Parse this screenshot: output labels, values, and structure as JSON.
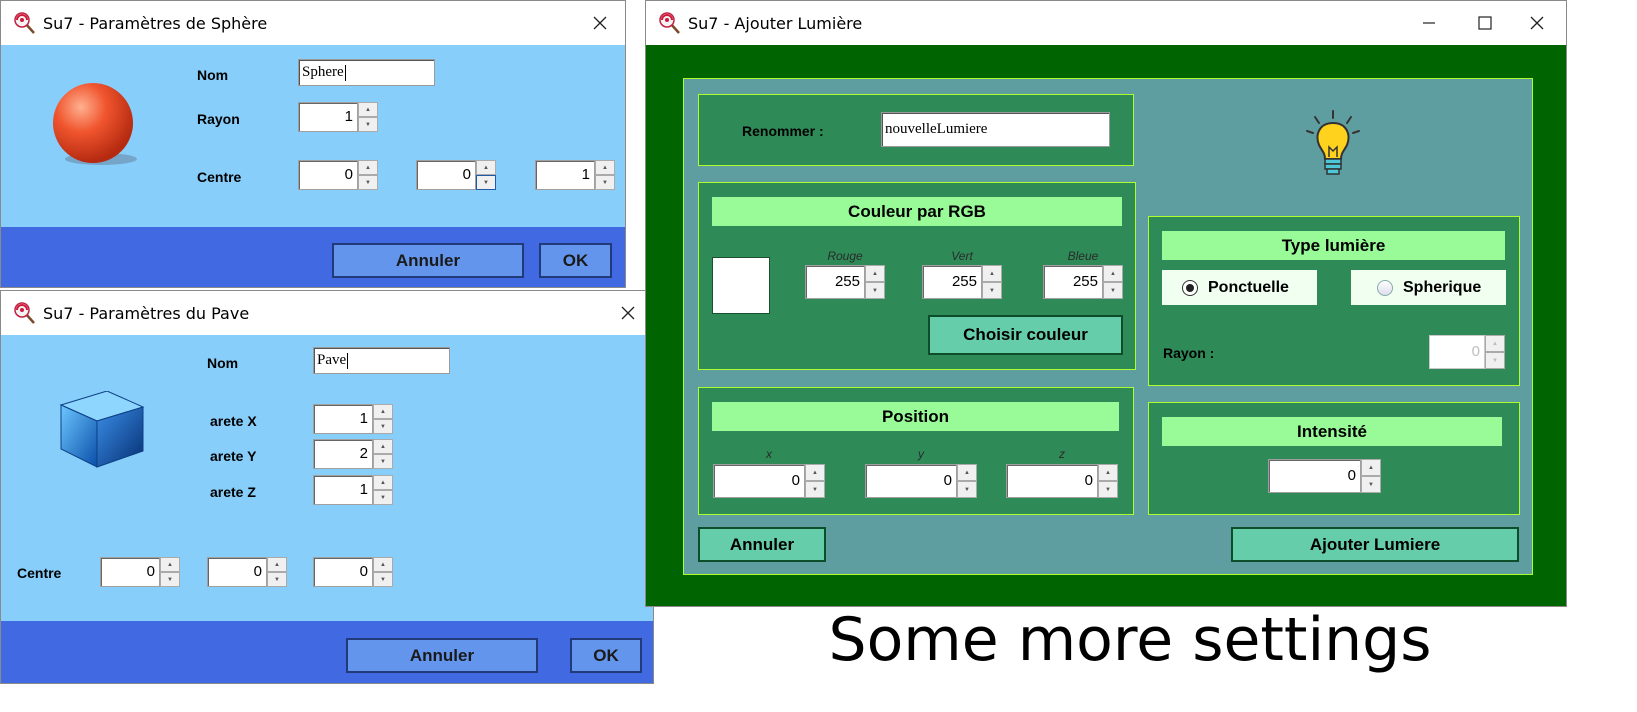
{
  "sphere_window": {
    "title": "Su7 - Paramètres de Sphère",
    "name_label": "Nom",
    "name_value": "Sphere",
    "rayon_label": "Rayon",
    "rayon_value": "1",
    "centre_label": "Centre",
    "centre_values": [
      "0",
      "0",
      "1"
    ],
    "cancel_label": "Annuler",
    "ok_label": "OK",
    "colors": {
      "body": "#87cefa",
      "footer": "#4169e1",
      "button": "#6495ed"
    }
  },
  "pave_window": {
    "title": "Su7 - Paramètres du Pave",
    "name_label": "Nom",
    "name_value": "Pave",
    "edges": [
      {
        "label": "arete X",
        "value": "1"
      },
      {
        "label": "arete Y",
        "value": "2"
      },
      {
        "label": "arete Z",
        "value": "1"
      }
    ],
    "centre_label": "Centre",
    "centre_values": [
      "0",
      "0",
      "0"
    ],
    "cancel_label": "Annuler",
    "ok_label": "OK"
  },
  "light_window": {
    "title": "Su7 - Ajouter Lumière",
    "rename_label": "Renommer :",
    "rename_value": "nouvelleLumiere",
    "color_header": "Couleur par RGB",
    "rgb": [
      {
        "label": "Rouge",
        "value": "255"
      },
      {
        "label": "Vert",
        "value": "255"
      },
      {
        "label": "Bleue",
        "value": "255"
      }
    ],
    "color_preview": "#ffffff",
    "choose_color_label": "Choisir couleur",
    "position_header": "Position",
    "position": [
      {
        "label": "x",
        "value": "0"
      },
      {
        "label": "y",
        "value": "0"
      },
      {
        "label": "z",
        "value": "0"
      }
    ],
    "type_header": "Type lumière",
    "type_options": [
      {
        "label": "Ponctuelle",
        "selected": true
      },
      {
        "label": "Spherique",
        "selected": false
      }
    ],
    "rayon_label": "Rayon :",
    "rayon_value": "0",
    "intensity_header": "Intensité",
    "intensity_value": "0",
    "cancel_label": "Annuler",
    "add_label": "Ajouter Lumiere",
    "colors": {
      "frame": "#006400",
      "inner": "#5f9ea0",
      "panel": "#2e8b57",
      "header": "#98fb98",
      "button": "#66cdaa"
    }
  },
  "caption": "Some more settings"
}
